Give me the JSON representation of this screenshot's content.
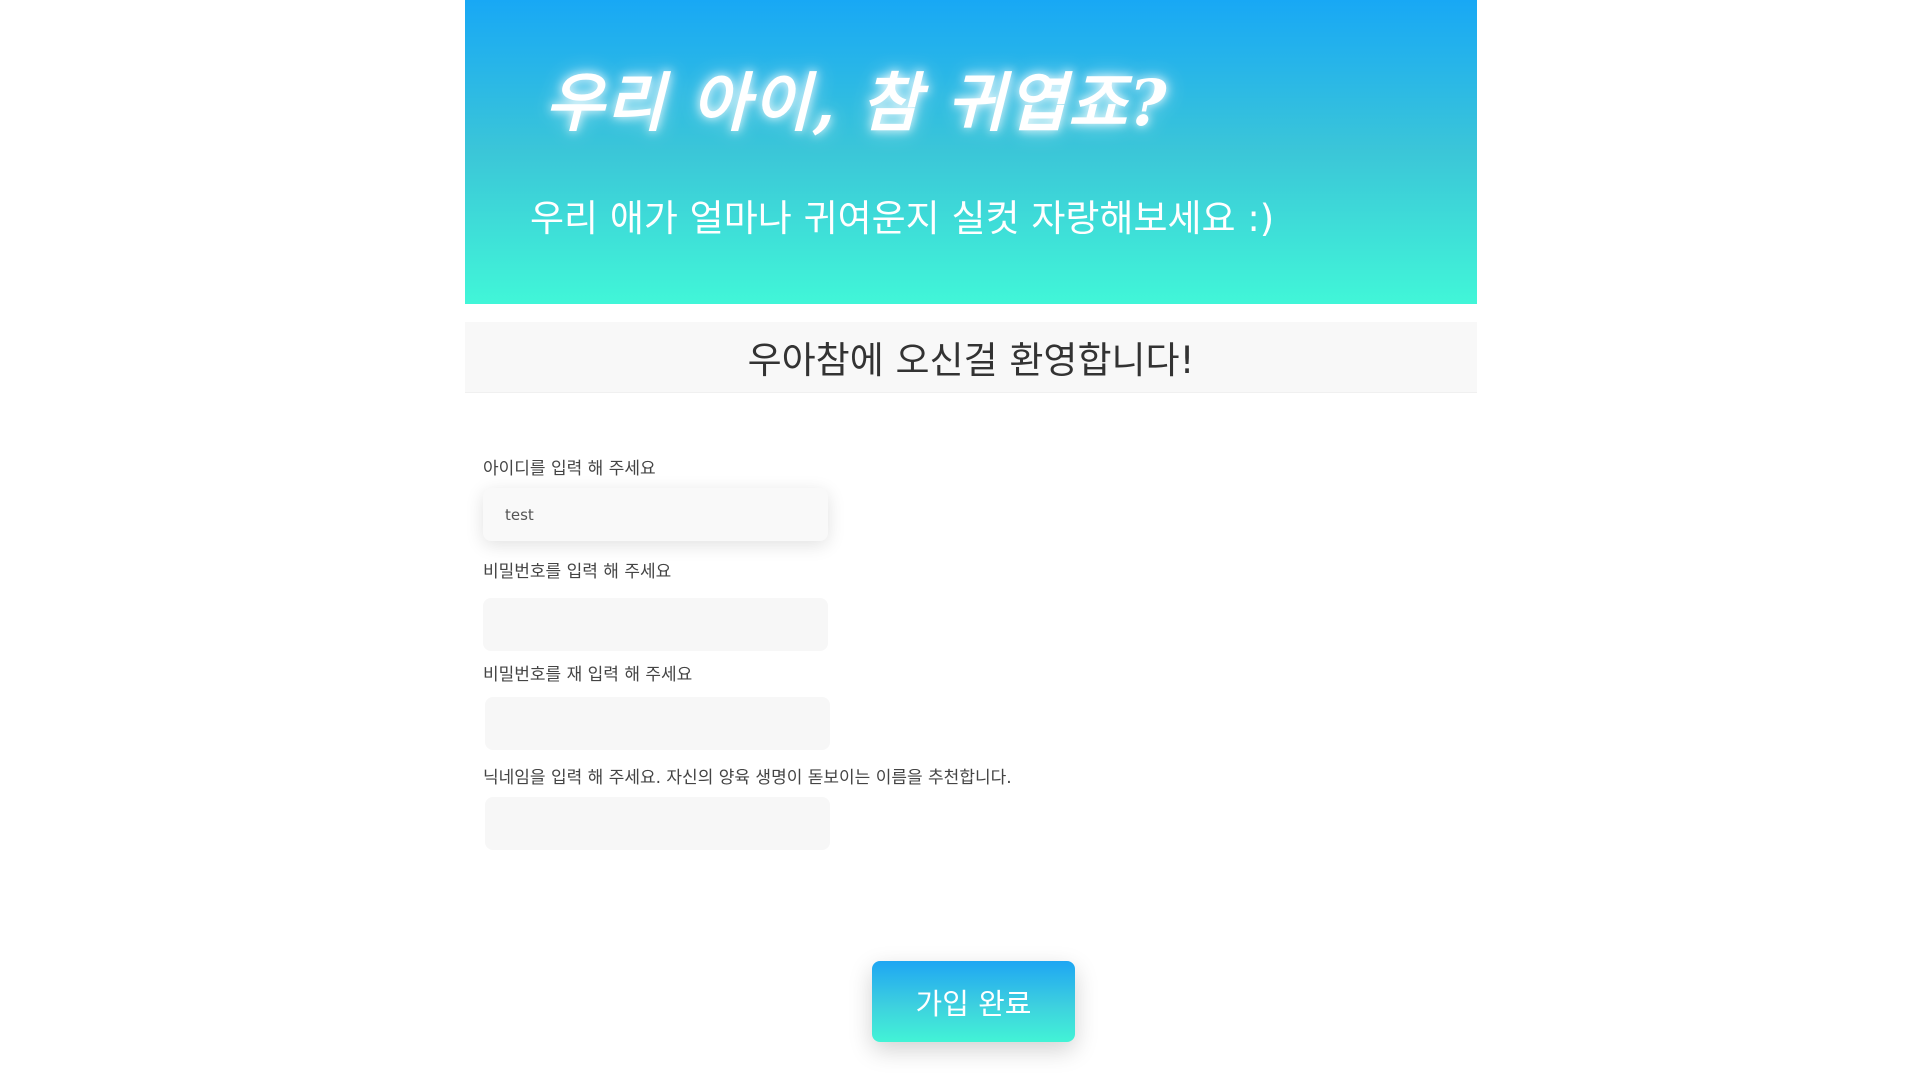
{
  "hero": {
    "title": "우리 아이, 참 귀엽죠?",
    "subtitle": "우리 애가 얼마나 귀여운지 실컷 자랑해보세요 :)"
  },
  "welcome": {
    "text": "우아참에 오신걸 환영합니다!"
  },
  "form": {
    "fields": [
      {
        "label": "아이디를 입력 해 주세요",
        "value": "test",
        "placeholder": ""
      },
      {
        "label": "비밀번호를 입력 해 주세요",
        "value": "",
        "placeholder": ""
      },
      {
        "label": "비밀번호를 재 입력 해 주세요",
        "value": "",
        "placeholder": ""
      },
      {
        "label": "닉네임을 입력 해 주세요. 자신의 양육 생명이 돋보이는 이름을 추천합니다.",
        "value": "",
        "placeholder": ""
      }
    ],
    "submit_label": "가입 완료"
  },
  "colors": {
    "gradient_top": "#18a8f5",
    "gradient_bottom": "#41f6d8",
    "input_background": "#f7f7f7",
    "welcome_background": "#f8f8f8"
  }
}
